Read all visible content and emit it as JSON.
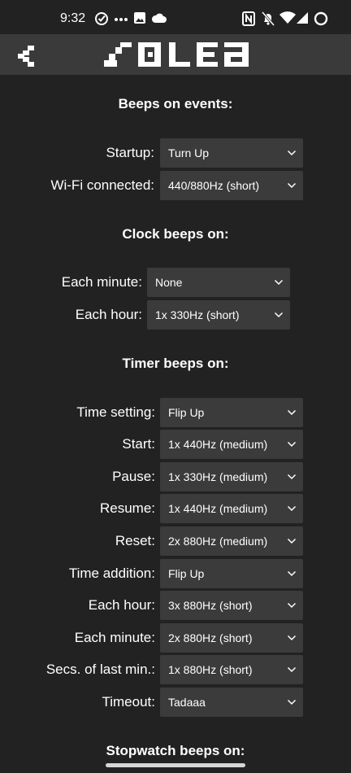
{
  "status": {
    "time": "9:32"
  },
  "appbar": {
    "logo_text": "SOLEA"
  },
  "sections": [
    {
      "title": "Beeps on events:",
      "rows": [
        {
          "label": "Startup:",
          "value": "Turn Up"
        },
        {
          "label": "Wi-Fi connected:",
          "value": "440/880Hz (short)"
        }
      ]
    },
    {
      "title": "Clock beeps on:",
      "rows": [
        {
          "label": "Each minute:",
          "value": "None"
        },
        {
          "label": "Each hour:",
          "value": "1x 330Hz (short)"
        }
      ]
    },
    {
      "title": "Timer beeps on:",
      "rows": [
        {
          "label": "Time setting:",
          "value": "Flip Up"
        },
        {
          "label": "Start:",
          "value": "1x 440Hz (medium)"
        },
        {
          "label": "Pause:",
          "value": "1x 330Hz (medium)"
        },
        {
          "label": "Resume:",
          "value": "1x 440Hz (medium)"
        },
        {
          "label": "Reset:",
          "value": "2x 880Hz (medium)"
        },
        {
          "label": "Time addition:",
          "value": "Flip Up"
        },
        {
          "label": "Each hour:",
          "value": "3x 880Hz (short)"
        },
        {
          "label": "Each minute:",
          "value": "2x 880Hz (short)"
        },
        {
          "label": "Secs. of last min.:",
          "value": "1x 880Hz (short)"
        },
        {
          "label": "Timeout:",
          "value": "Tadaaa"
        }
      ]
    },
    {
      "title": "Stopwatch beeps on:",
      "rows": []
    }
  ],
  "icons": [
    "check-circle-icon",
    "more-dots-icon",
    "image-icon",
    "cloud-icon",
    "nfc-icon",
    "bell-off-icon",
    "wifi-icon",
    "signal-icon",
    "battery-circle-icon",
    "back-chevron-icon",
    "chevron-down-icon"
  ],
  "colors": {
    "background": "#222222",
    "appbar": "#3a3a3a",
    "select": "#3b3b3b",
    "text": "#ffffff"
  }
}
